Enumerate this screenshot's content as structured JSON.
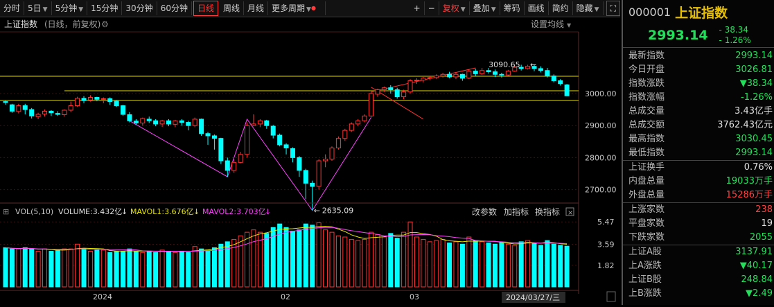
{
  "toolbar": {
    "periods": [
      "分时",
      "5日",
      "5分钟",
      "15分钟",
      "30分钟",
      "60分钟",
      "日线",
      "周线",
      "月线",
      "更多周期"
    ],
    "active_period": "日线",
    "plus": "+",
    "minus": "−",
    "fuquan": "复权",
    "diejia": "叠加",
    "chouma": "筹码",
    "huaxian": "画线",
    "jianyue": "简约",
    "yincang": "隐藏"
  },
  "chart": {
    "title": "上证指数",
    "subtitle": "(日线，前复权)",
    "settings_label": "设置均线",
    "price_ticks": [
      "3000.00",
      "2900.00",
      "2800.00",
      "2700.00"
    ],
    "high_label": "3090.65",
    "low_label": "2635.09",
    "date_labels": [
      "2024",
      "02",
      "03"
    ],
    "cursor_date": "2024/03/27/三"
  },
  "volume": {
    "header": "VOL(5,10)",
    "volume_label": "VOLUME:3.432亿",
    "mavol1_label": "MAVOL1:3.676亿",
    "mavol2_label": "MAVOL2:3.703亿",
    "ticks": [
      "5.47",
      "3.59",
      "1.82"
    ],
    "btn_params": "改参数",
    "btn_add": "加指标",
    "btn_switch": "换指标"
  },
  "quote": {
    "code": "000001",
    "name": "上证指数",
    "price": "2993.14",
    "change": "- 38.34",
    "change_pct": "- 1.26%",
    "rows": [
      {
        "label": "最新指数",
        "value": "2993.14",
        "color": "dn"
      },
      {
        "label": "今日开盘",
        "value": "3026.81",
        "color": "dn"
      },
      {
        "label": "指数涨跌",
        "value": "▼38.34",
        "color": "dn"
      },
      {
        "label": "指数涨幅",
        "value": "-1.26%",
        "color": "dn"
      },
      {
        "label": "总成交量",
        "value": "3.43亿手",
        "color": "wh"
      },
      {
        "label": "总成交额",
        "value": "3762.43亿元",
        "color": "wh"
      },
      {
        "label": "最高指数",
        "value": "3030.45",
        "color": "dn"
      },
      {
        "label": "最低指数",
        "value": "2993.14",
        "color": "dn"
      },
      {
        "label": "上证换手",
        "value": "0.76%",
        "color": "wh"
      },
      {
        "label": "内盘总量",
        "value": "19033万手",
        "color": "dn"
      },
      {
        "label": "外盘总量",
        "value": "15286万手",
        "color": "up"
      },
      {
        "label": "上涨家数",
        "value": "238",
        "color": "up"
      },
      {
        "label": "平盘家数",
        "value": "19",
        "color": "wh"
      },
      {
        "label": "下跌家数",
        "value": "2055",
        "color": "dn"
      },
      {
        "label": "上证A股",
        "value": "3137.91",
        "color": "dn"
      },
      {
        "label": "上A涨跌",
        "value": "▼40.17",
        "color": "dn"
      },
      {
        "label": "上证B股",
        "value": "248.84",
        "color": "dn"
      },
      {
        "label": "上B涨跌",
        "value": "▼2.49",
        "color": "dn"
      }
    ]
  },
  "colors": {
    "up": "#ff3232",
    "down": "#00ffff",
    "mavol1": "#e8e800",
    "mavol2": "#ff40ff",
    "hline": "#e6d800",
    "pattern": "#ff40ff"
  }
}
